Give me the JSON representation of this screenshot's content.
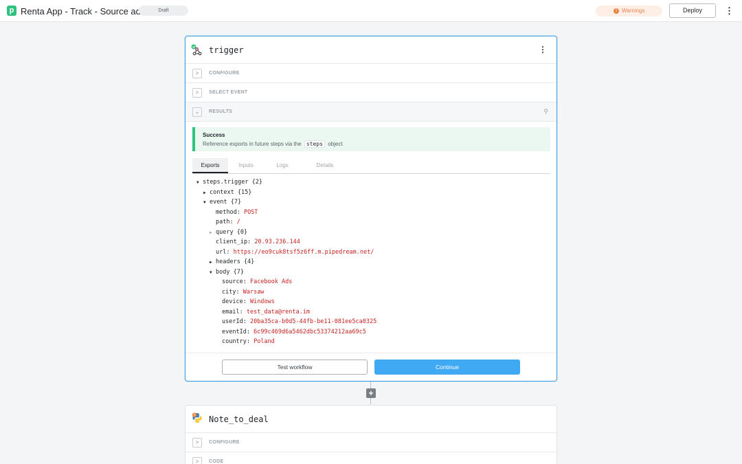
{
  "topbar": {
    "logo_letter": "p",
    "title": "Renta App - Track - Source added",
    "status_badge": "Draft",
    "warnings_label": "Warnings",
    "warnings_icon": "!",
    "deploy_label": "Deploy",
    "menu_icon": "⋮"
  },
  "trigger_card": {
    "title": "trigger",
    "menu_icon": "⋮",
    "sections": {
      "configure": "CONFIGURE",
      "select_event": "SELECT EVENT",
      "results": "RESULTS"
    },
    "success": {
      "title": "Success",
      "text_before": "Reference exports in future steps via the",
      "code": "steps",
      "text_after": "object"
    },
    "tabs": [
      "Exports",
      "Inputs",
      "Logs",
      "Details"
    ],
    "active_tab": "Exports",
    "tree": {
      "root": "steps.trigger {2}",
      "context": "context {15}",
      "event": "event {7}",
      "method_key": "method:",
      "method_val": "POST",
      "path_key": "path:",
      "path_val": "/",
      "query": "query {0}",
      "client_ip_key": "client_ip:",
      "client_ip_val": "20.93.236.144",
      "url_key": "url:",
      "url_val": "https://eo9cuk8tsf5z6ff.m.pipedream.net/",
      "headers": "headers {4}",
      "body": "body {7}",
      "source_key": "source:",
      "source_val": "Facebook Ads",
      "city_key": "city:",
      "city_val": "Warsaw",
      "device_key": "device:",
      "device_val": "Windows",
      "email_key": "email:",
      "email_val": "test_data@renta.im",
      "userId_key": "userId:",
      "userId_val": "20ba35ca-b0d5-44fb-be11-081ee5ca0325",
      "eventId_key": "eventId:",
      "eventId_val": "6c99c469d6a5462dbc53374212aa69c5",
      "country_key": "country:",
      "country_val": "Poland"
    },
    "buttons": {
      "test": "Test workflow",
      "continue": "Continue"
    }
  },
  "add_step_icon": "+",
  "note_card": {
    "title": "Note_to_deal",
    "sections": {
      "configure": "CONFIGURE",
      "code": "CODE"
    }
  },
  "colors": {
    "accent": "#40a9f4",
    "success": "#2fc27e",
    "value_red": "#c4221f",
    "warning": "#e78553"
  }
}
